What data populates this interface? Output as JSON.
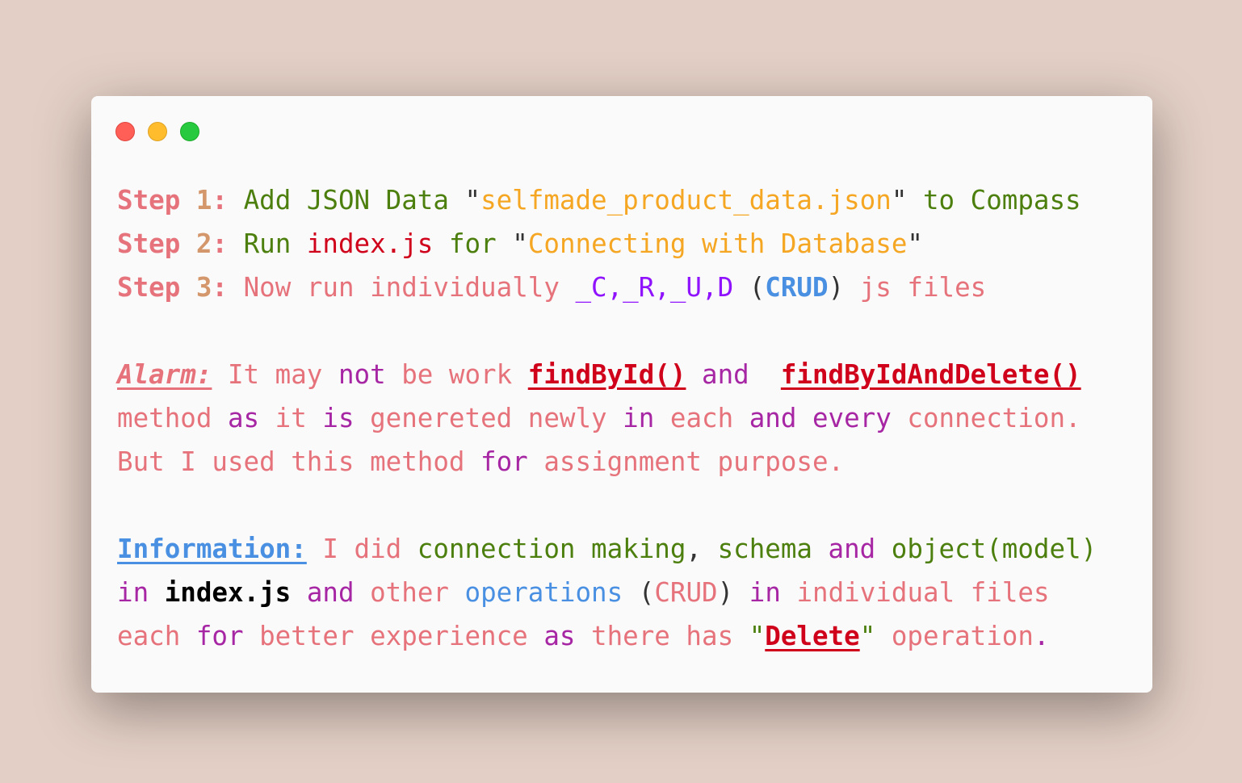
{
  "window": {
    "buttons": [
      "close",
      "minimize",
      "maximize"
    ]
  },
  "colors": {
    "pink": "#e6737b",
    "tan": "#d4976c",
    "green": "#4c7f0e",
    "orange": "#f5a623",
    "red": "#d0021b",
    "purple": "#a626a4",
    "violet": "#9013fe",
    "blue": "#4a90e2",
    "background": "#e3cfc5",
    "window": "#fafafa"
  },
  "lines": [
    {
      "segs": [
        {
          "t": "Step ",
          "c": "pink b"
        },
        {
          "t": "1",
          "c": "tan b"
        },
        {
          "t": ": ",
          "c": "pink b"
        },
        {
          "t": "Add JSON Data ",
          "c": "green"
        },
        {
          "t": "\"",
          "c": "dark"
        },
        {
          "t": "selfmade_product_data.json",
          "c": "orange"
        },
        {
          "t": "\" ",
          "c": "dark"
        },
        {
          "t": "to Compass",
          "c": "green"
        }
      ]
    },
    {
      "segs": [
        {
          "t": "Step ",
          "c": "pink b"
        },
        {
          "t": "2",
          "c": "tan b"
        },
        {
          "t": ": ",
          "c": "pink b"
        },
        {
          "t": "Run ",
          "c": "green"
        },
        {
          "t": "index.js",
          "c": "red"
        },
        {
          "t": " for ",
          "c": "green"
        },
        {
          "t": "\"",
          "c": "dark"
        },
        {
          "t": "Connecting with Database",
          "c": "orange"
        },
        {
          "t": "\"",
          "c": "dark"
        }
      ]
    },
    {
      "segs": [
        {
          "t": "Step ",
          "c": "pink b"
        },
        {
          "t": "3",
          "c": "tan b"
        },
        {
          "t": ": ",
          "c": "pink b"
        },
        {
          "t": "Now run individually ",
          "c": "pink"
        },
        {
          "t": "_C,_R,_U,D",
          "c": "violet"
        },
        {
          "t": " (",
          "c": "dark"
        },
        {
          "t": "CRUD",
          "c": "blue b"
        },
        {
          "t": ")",
          "c": "dark"
        },
        {
          "t": " js files",
          "c": "pink"
        }
      ]
    },
    {
      "segs": []
    },
    {
      "segs": [
        {
          "t": "Alarm:",
          "c": "pink b i u"
        },
        {
          "t": " It may ",
          "c": "pink"
        },
        {
          "t": "not",
          "c": "purple"
        },
        {
          "t": " be work ",
          "c": "pink"
        },
        {
          "t": "findById()",
          "c": "red b u"
        },
        {
          "t": " ",
          "c": "pink"
        },
        {
          "t": "and",
          "c": "purple"
        },
        {
          "t": "  ",
          "c": "pink"
        },
        {
          "t": "findByIdAndDelete()",
          "c": "red b u"
        }
      ]
    },
    {
      "segs": [
        {
          "t": "method ",
          "c": "pink"
        },
        {
          "t": "as",
          "c": "purple"
        },
        {
          "t": " it ",
          "c": "pink"
        },
        {
          "t": "is",
          "c": "purple"
        },
        {
          "t": " genereted newly ",
          "c": "pink"
        },
        {
          "t": "in",
          "c": "purple"
        },
        {
          "t": " each ",
          "c": "pink"
        },
        {
          "t": "and every",
          "c": "purple"
        },
        {
          "t": " connection.",
          "c": "pink"
        }
      ]
    },
    {
      "segs": [
        {
          "t": "But I used this method ",
          "c": "pink"
        },
        {
          "t": "for",
          "c": "purple"
        },
        {
          "t": " assignment purpose.",
          "c": "pink"
        }
      ]
    },
    {
      "segs": []
    },
    {
      "segs": [
        {
          "t": "Information:",
          "c": "blue b u"
        },
        {
          "t": " I did ",
          "c": "pink"
        },
        {
          "t": "connection making",
          "c": "green"
        },
        {
          "t": ", ",
          "c": "dark"
        },
        {
          "t": "schema ",
          "c": "green"
        },
        {
          "t": "and",
          "c": "purple"
        },
        {
          "t": " object(model)",
          "c": "green"
        }
      ]
    },
    {
      "segs": [
        {
          "t": "in",
          "c": "purple"
        },
        {
          "t": " ",
          "c": "pink"
        },
        {
          "t": "index.js",
          "c": "black b"
        },
        {
          "t": " ",
          "c": "pink"
        },
        {
          "t": "and",
          "c": "purple"
        },
        {
          "t": " other ",
          "c": "pink"
        },
        {
          "t": "operations",
          "c": "blue"
        },
        {
          "t": " (",
          "c": "dark"
        },
        {
          "t": "CRUD",
          "c": "pink"
        },
        {
          "t": ")",
          "c": "dark"
        },
        {
          "t": " ",
          "c": "pink"
        },
        {
          "t": "in",
          "c": "purple"
        },
        {
          "t": " individual files",
          "c": "pink"
        }
      ]
    },
    {
      "segs": [
        {
          "t": "each ",
          "c": "pink"
        },
        {
          "t": "for",
          "c": "purple"
        },
        {
          "t": " better experience ",
          "c": "pink"
        },
        {
          "t": "as",
          "c": "purple"
        },
        {
          "t": " there has ",
          "c": "pink"
        },
        {
          "t": "\"",
          "c": "green"
        },
        {
          "t": "Delete",
          "c": "red b u"
        },
        {
          "t": "\"",
          "c": "green"
        },
        {
          "t": " operation",
          "c": "pink"
        },
        {
          "t": ".",
          "c": "purple"
        }
      ]
    }
  ]
}
